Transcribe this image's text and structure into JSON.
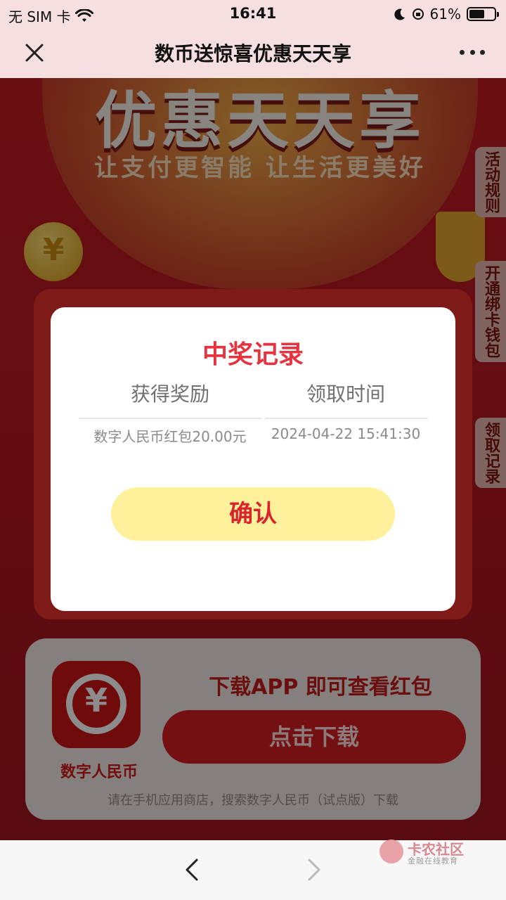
{
  "status": {
    "carrier": "无 SIM 卡",
    "time": "16:41",
    "battery_pct": "61%",
    "battery_level": 0.61
  },
  "nav": {
    "title": "数币送惊喜优惠天天享",
    "close_icon": "close-icon",
    "more_icon": "more-dots-icon"
  },
  "banner": {
    "title": "优惠天天享",
    "subtitle": "让支付更智能 让生活更美好"
  },
  "side_tabs": [
    {
      "label": "活动规则"
    },
    {
      "label": "开通绑卡钱包"
    },
    {
      "label": "领取记录"
    }
  ],
  "download": {
    "app_name": "数字人民币",
    "title": "下载APP 即可查看红包",
    "button": "点击下载",
    "note": "请在手机应用商店，搜索数字人民币（试点版）下载"
  },
  "modal": {
    "title": "中奖记录",
    "columns": [
      "获得奖励",
      "领取时间"
    ],
    "rows": [
      {
        "reward": "数字人民币红包20.00元",
        "time": "2024-04-22 15:41:30"
      }
    ],
    "confirm_label": "确认"
  },
  "watermark": {
    "title": "卡农社区",
    "subtitle": "金融在线教育"
  },
  "colors": {
    "accent_red": "#e5343f",
    "confirm_bg": "#fff09b",
    "nav_bg": "#f6dfe0"
  }
}
